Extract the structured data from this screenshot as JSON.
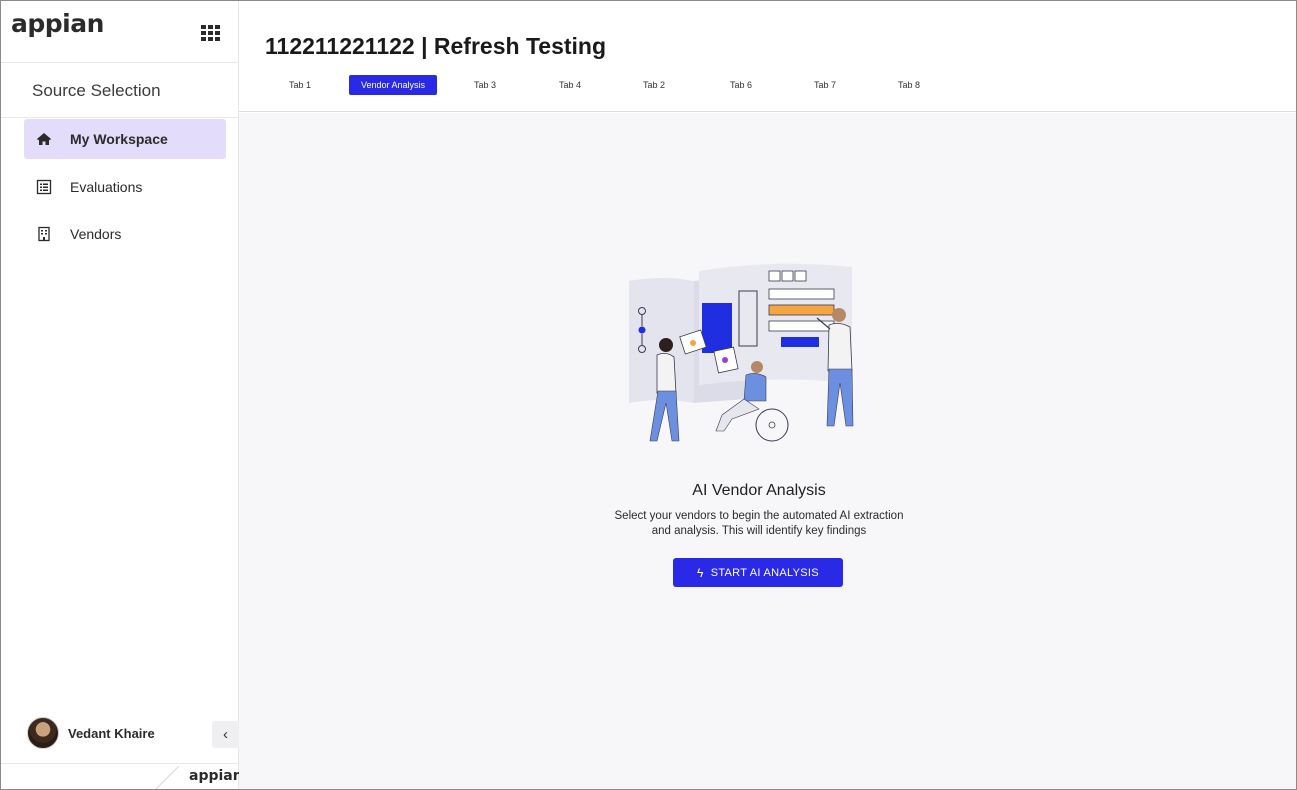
{
  "app": {
    "logo_text": "appian",
    "footer_logo_text": "appian"
  },
  "sidebar": {
    "title": "Source Selection",
    "items": [
      {
        "label": "My Workspace",
        "icon": "home-icon",
        "active": true
      },
      {
        "label": "Evaluations",
        "icon": "list-icon",
        "active": false
      },
      {
        "label": "Vendors",
        "icon": "building-icon",
        "active": false
      }
    ],
    "user": {
      "name": "Vedant Khaire"
    },
    "collapse_glyph": "‹"
  },
  "header": {
    "title": "112211221122 | Refresh Testing",
    "tabs": [
      {
        "label": "Tab 1",
        "active": false
      },
      {
        "label": "Vendor Analysis",
        "active": true
      },
      {
        "label": "Tab 3",
        "active": false
      },
      {
        "label": "Tab 4",
        "active": false
      },
      {
        "label": "Tab 2",
        "active": false
      },
      {
        "label": "Tab 6",
        "active": false
      },
      {
        "label": "Tab 7",
        "active": false
      },
      {
        "label": "Tab 8",
        "active": false
      }
    ]
  },
  "main": {
    "hero_title": "AI Vendor Analysis",
    "hero_description": "Select your vendors to begin the automated AI extraction and analysis. This will identify key findings",
    "start_button_label": "START AI ANALYSIS"
  },
  "colors": {
    "accent": "#2a2ae6",
    "active_nav_bg": "#e3dcfa",
    "main_bg": "#f7f7fa",
    "illustration_orange": "#f5a640",
    "illustration_blue": "#1f2ee0"
  }
}
